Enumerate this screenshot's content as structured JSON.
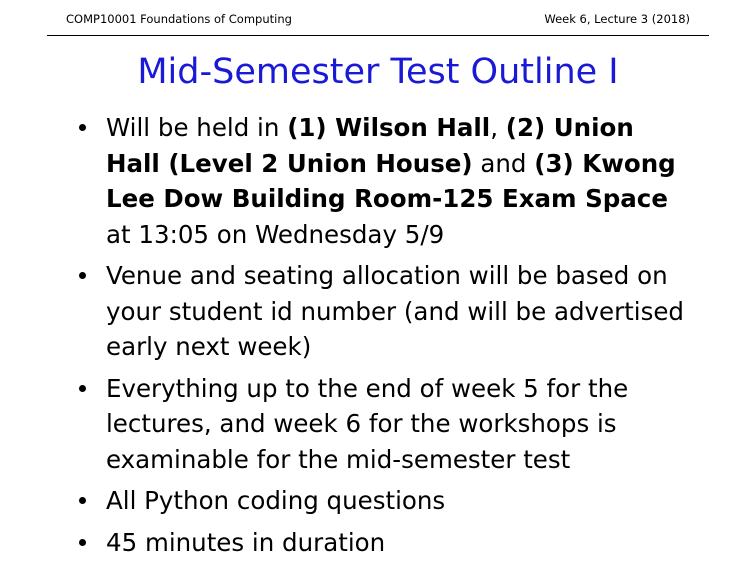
{
  "header": {
    "left": "COMP10001 Foundations of Computing",
    "right": "Week 6, Lecture 3 (2018)"
  },
  "title": "Mid-Semester Test Outline I",
  "bullets": {
    "b0": {
      "l0": "Will be held in ",
      "l0_bold1": "(1) Wilson Hall",
      "l0_sep": ", ",
      "l0_bold2": "(2) Union",
      "l1_bold": "Hall (Level 2 Union House)",
      "l1_and": " and ",
      "l1_bold2": "(3) Kwong",
      "l2_bold": "Lee Dow Building Room-125 Exam Space",
      "l3": "at 13:05 on Wednesday 5/9"
    },
    "b1": {
      "l0": "Venue and seating allocation will be based on",
      "l1": "your student id number (and will be advertised",
      "l2": "early next week)"
    },
    "b2": {
      "l0": "Everything up to the end of week 5 for the",
      "l1": "lectures, and week 6 for the workshops is",
      "l2": "examinable for the mid-semester test"
    },
    "b3": {
      "l0": "All Python coding questions"
    },
    "b4": {
      "l0": "45 minutes in duration"
    }
  }
}
